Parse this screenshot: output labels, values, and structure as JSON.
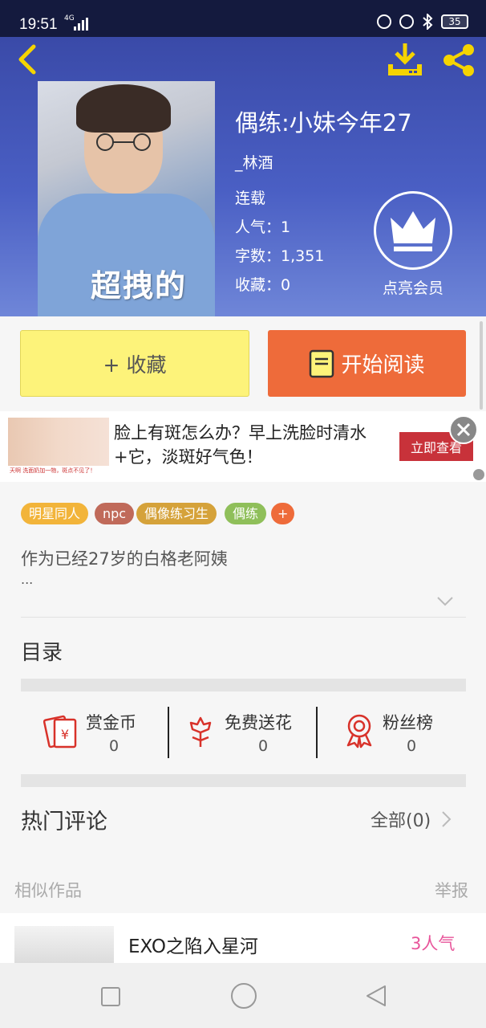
{
  "status": {
    "time": "19:51",
    "network": "4G",
    "battery": "35"
  },
  "book": {
    "title": "偶练:小妹今年27",
    "author": "_林酒",
    "status": "连载",
    "popularity": "人气：1",
    "word_count": "字数：1,351",
    "favorites": "收藏：0",
    "cover_text": "超拽的"
  },
  "vip": {
    "label": "点亮会员"
  },
  "actions": {
    "collect_label": "+ 收藏",
    "read_label": "开始阅读"
  },
  "ad": {
    "text": "脸上有斑怎么办？早上洗脸时清水+它，淡斑好气色！",
    "button": "立即查看",
    "image_caption": "天啊  洗面奶加一物，斑点不见了！"
  },
  "tags": [
    {
      "label": "明星同人",
      "color": "#f2b43a"
    },
    {
      "label": "npc",
      "color": "#c06a5a"
    },
    {
      "label": "偶像练习生",
      "color": "#d5a23a"
    },
    {
      "label": "偶练",
      "color": "#8fbf5a"
    },
    {
      "label": "+",
      "color": "#ee6b3a"
    }
  ],
  "description": {
    "text": "作为已经27岁的白格老阿姨",
    "ellipsis": "..."
  },
  "catalog": {
    "title": "目录"
  },
  "stats": [
    {
      "label": "赏金币",
      "value": "0",
      "icon": "coin-envelope-icon"
    },
    {
      "label": "免费送花",
      "value": "0",
      "icon": "flower-icon"
    },
    {
      "label": "粉丝榜",
      "value": "0",
      "icon": "medal-icon"
    }
  ],
  "comments": {
    "title": "热门评论",
    "all_label": "全部(0)"
  },
  "similar": {
    "title": "相似作品",
    "report": "举报",
    "items": [
      {
        "name": "EXO之陷入星河",
        "popularity": "3人气"
      }
    ]
  },
  "colors": {
    "accent": "#ee6b3a",
    "header": "#3a4aa8",
    "collect": "#fdf37a",
    "popularity": "#e8549a"
  }
}
